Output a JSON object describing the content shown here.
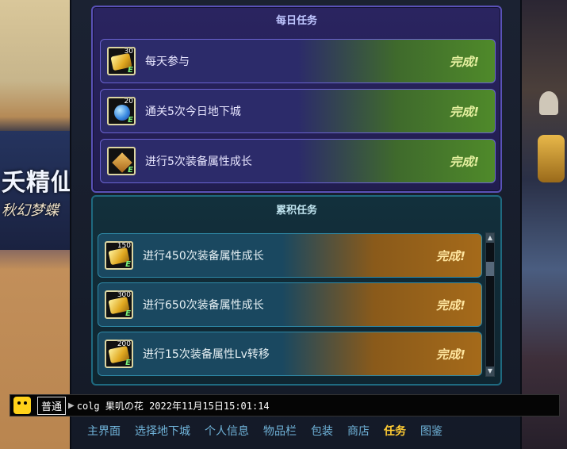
{
  "banner": {
    "line1": "夭精仙",
    "line2": "秋幻梦蝶"
  },
  "daily": {
    "title": "每日任务",
    "tasks": [
      {
        "icon": "gold-coin-icon",
        "count": "30",
        "name": "每天参与",
        "status": "完成!"
      },
      {
        "icon": "blue-gem-icon",
        "count": "20",
        "name": "通关5次今日地下城",
        "status": "完成!"
      },
      {
        "icon": "equipment-chip-icon",
        "count": "",
        "name": "进行5次装备属性成长",
        "status": "完成!"
      }
    ]
  },
  "accumulated": {
    "title": "累积任务",
    "tasks": [
      {
        "icon": "gold-coin-icon",
        "count": "150",
        "name": "进行450次装备属性成长",
        "status": "完成!"
      },
      {
        "icon": "gold-coin-icon",
        "count": "300",
        "name": "进行650次装备属性成长",
        "status": "完成!"
      },
      {
        "icon": "gold-coin-icon",
        "count": "200",
        "name": "进行15次装备属性Lv转移",
        "status": "完成!"
      }
    ]
  },
  "chat": {
    "channel": "普通",
    "message": "colg 果叽の花 2022年11月15日15:01:14"
  },
  "nav": [
    "主界面",
    "选择地下城",
    "个人信息",
    "物品栏",
    "包装",
    "商店",
    "任务",
    "图鉴"
  ],
  "nav_active": "任务"
}
